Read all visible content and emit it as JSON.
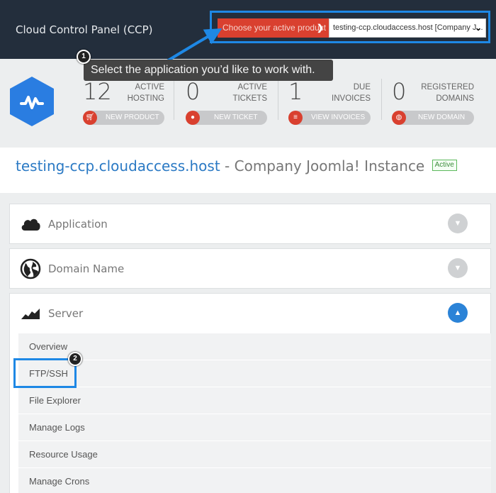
{
  "header": {
    "title": "Cloud Control Panel (CCP)",
    "product_label": "Choose your active product",
    "product_label_icon": "chevron-right-icon",
    "product_selected": "testing-ccp.cloudaccess.host [Company J..."
  },
  "callouts": {
    "step1_number": "1",
    "step1_text": "Select the application you’d like to work with.",
    "step2_number": "2"
  },
  "stats": [
    {
      "number": "12",
      "label_line1": "ACTIVE",
      "label_line2": "HOSTING",
      "button": "NEW PRODUCT",
      "icon": "cart-icon"
    },
    {
      "number": "0",
      "label_line1": "ACTIVE",
      "label_line2": "TICKETS",
      "button": "NEW TICKET",
      "icon": "comment-icon"
    },
    {
      "number": "1",
      "label_line1": "DUE",
      "label_line2": "INVOICES",
      "button": "VIEW INVOICES",
      "icon": "invoice-icon"
    },
    {
      "number": "0",
      "label_line1": "REGISTERED",
      "label_line2": "DOMAINS",
      "button": "NEW DOMAIN",
      "icon": "globe-icon"
    }
  ],
  "instance": {
    "host": "testing-ccp.cloudaccess.host",
    "separator": " - ",
    "name": "Company Joomla! Instance",
    "status": "Active"
  },
  "panels": {
    "application": {
      "title": "Application",
      "icon": "cloud-icon",
      "state": "collapsed"
    },
    "domain": {
      "title": "Domain Name",
      "icon": "globe-icon",
      "state": "collapsed"
    },
    "server": {
      "title": "Server",
      "icon": "server-chart-icon",
      "state": "expanded",
      "items": [
        "Overview",
        "FTP/SSH",
        "File Explorer",
        "Manage Logs",
        "Resource Usage",
        "Manage Crons"
      ]
    }
  },
  "colors": {
    "header_bg": "#232e3c",
    "accent_red": "#d9402f",
    "highlight_blue": "#1e88e5",
    "link_blue": "#2a79c4",
    "toggle_open": "#2b83d7"
  }
}
